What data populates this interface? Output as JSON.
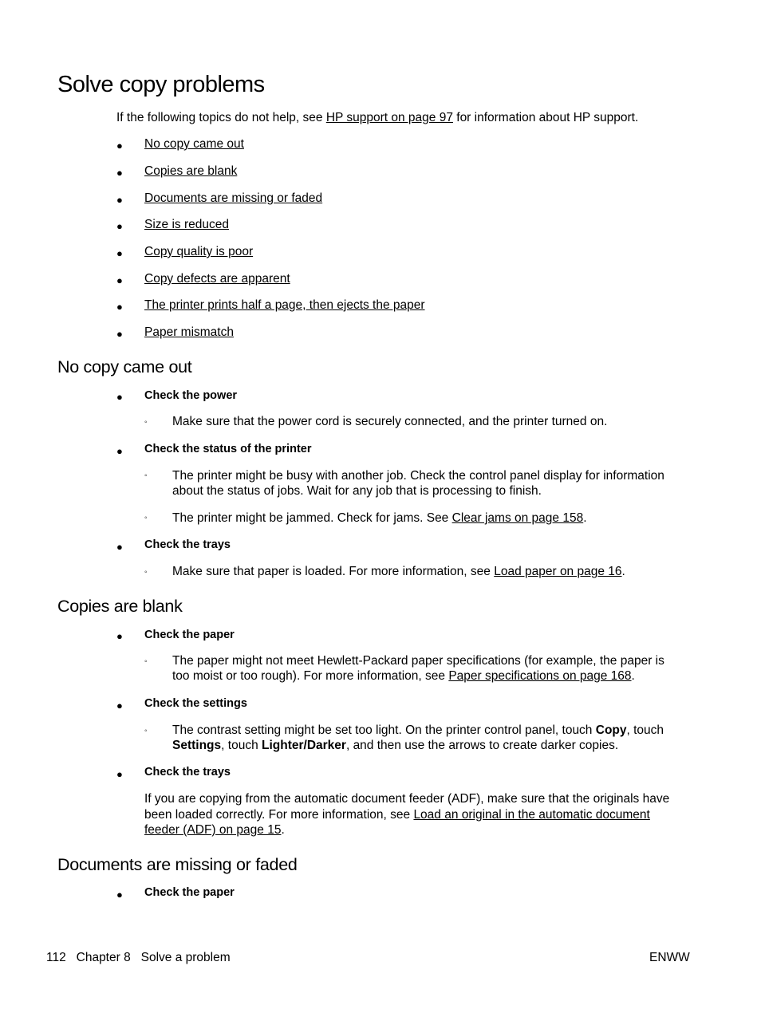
{
  "title": "Solve copy problems",
  "intro": {
    "before": "If the following topics do not help, see ",
    "link": "HP support on page 97",
    "after": " for information about HP support."
  },
  "topics": [
    "No copy came out",
    "Copies are blank",
    "Documents are missing or faded",
    "Size is reduced",
    "Copy quality is poor",
    "Copy defects are apparent",
    "The printer prints half a page, then ejects the paper",
    "Paper mismatch"
  ],
  "sections": {
    "no_copy": {
      "heading": "No copy came out",
      "power": {
        "label": "Check the power",
        "item": "Make sure that the power cord is securely connected, and the printer turned on."
      },
      "status": {
        "label": "Check the status of the printer",
        "item1_line1": "The printer might be busy with another job. Check the control panel display for information",
        "item1_line2": "about the status of jobs. Wait for any job that is processing to finish.",
        "item2_before": "The printer might be jammed. Check for jams. See ",
        "item2_link": "Clear jams on page 158",
        "item2_after": "."
      },
      "trays": {
        "label": "Check the trays",
        "item_before": "Make sure that paper is loaded. For more information, see ",
        "item_link": "Load paper on page 16",
        "item_after": "."
      }
    },
    "blank": {
      "heading": "Copies are blank",
      "paper": {
        "label": "Check the paper",
        "line1": "The paper might not meet Hewlett-Packard paper specifications (for example, the paper is",
        "line2_before": "too moist or too rough). For more information, see ",
        "line2_link": "Paper specifications on page 168",
        "line2_after": "."
      },
      "settings": {
        "label": "Check the settings",
        "line1_before": "The contrast setting might be set too light. On the printer control panel, touch ",
        "copy": "Copy",
        "line1_after": ", touch",
        "settings": "Settings",
        "line2_mid": ", touch ",
        "lighter": "Lighter/Darker",
        "line2_after": ", and then use the arrows to create darker copies."
      },
      "trays": {
        "label": "Check the trays",
        "line1": "If you are copying from the automatic document feeder (ADF), make sure that the originals have",
        "line2_before": "been loaded correctly. For more information, see ",
        "link_part1": "Load an original in the automatic document",
        "link_part2": "feeder (ADF) on page 15",
        "line3_after": "."
      }
    },
    "missing": {
      "heading": "Documents are missing or faded",
      "paper_label": "Check the paper"
    }
  },
  "footer": {
    "left": "112   Chapter 8   Solve a problem",
    "right": "ENWW"
  },
  "glyphs": {
    "bullet": "●",
    "sub_bullet": "◦"
  }
}
